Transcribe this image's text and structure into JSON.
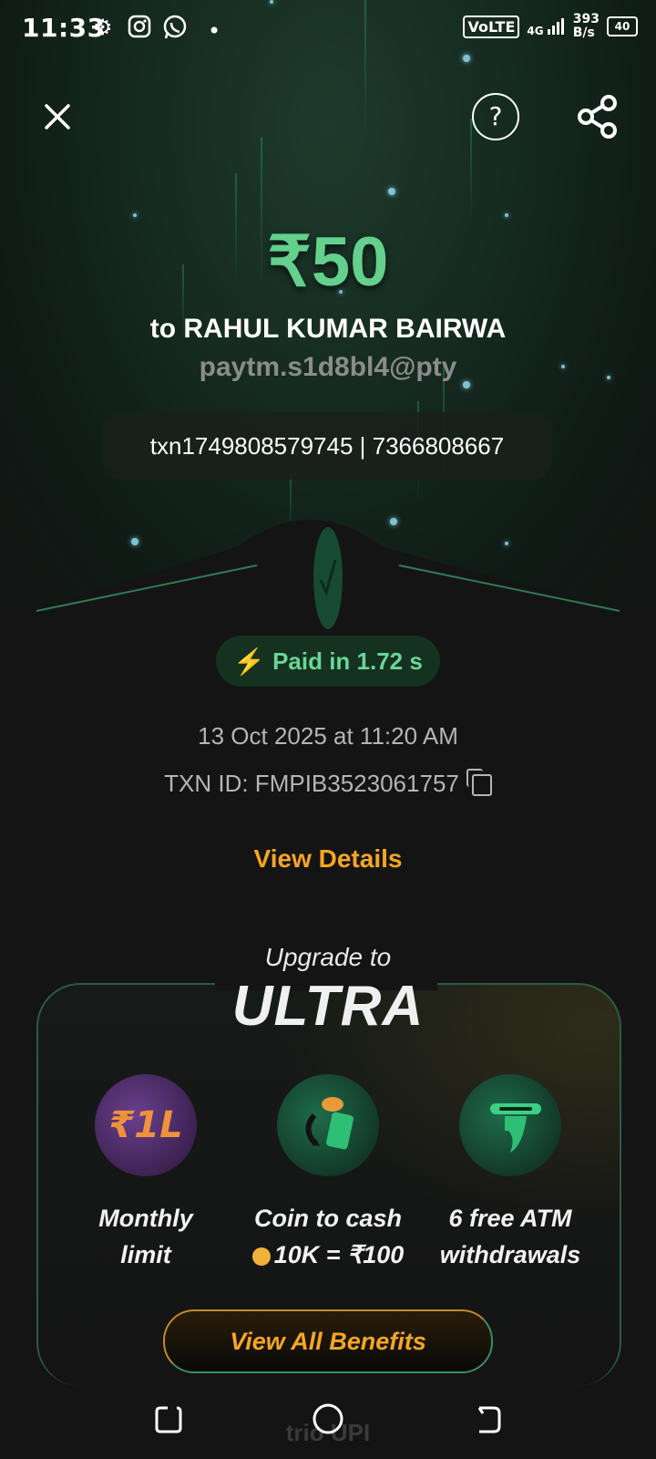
{
  "status_bar": {
    "time": "11:33",
    "icons": [
      "gear-icon",
      "instagram-icon",
      "whatsapp-icon",
      "dot-icon"
    ],
    "network": "VoLTE",
    "signal_type": "4G",
    "speed_value": "393",
    "speed_unit": "B/s",
    "battery": "40"
  },
  "header": {
    "close_icon": "close-icon",
    "help_label": "?",
    "share_icon": "share-icon"
  },
  "payment": {
    "amount": "₹50",
    "payee": "to RAHUL KUMAR BAIRWA",
    "vpa": "paytm.s1d8bl4@pty",
    "reference": "txn1749808579745 | 7366808667",
    "paid_badge": "Paid in 1.72 s",
    "datetime": "13 Oct 2025 at 11:20 AM",
    "txn_id": "TXN ID: FMPIB3523061757",
    "view_details": "View Details"
  },
  "promo": {
    "upgrade_to": "Upgrade to",
    "plan": "ULTRA",
    "benefits": [
      {
        "label_line1": "Monthly",
        "label_line2": "limit",
        "icon": "rupee-1L-icon"
      },
      {
        "label_line1": "Coin to cash",
        "label_line2": "10K = ₹100",
        "icon": "coin-to-cash-icon"
      },
      {
        "label_line1": "6 free ATM",
        "label_line2": "withdrawals",
        "icon": "atm-rupee-icon"
      }
    ],
    "cta": "View All Benefits"
  },
  "footer": {
    "brand": "trio UPI"
  },
  "colors": {
    "accent_green": "#63d08d",
    "accent_orange": "#f5a623",
    "background": "#141414"
  }
}
